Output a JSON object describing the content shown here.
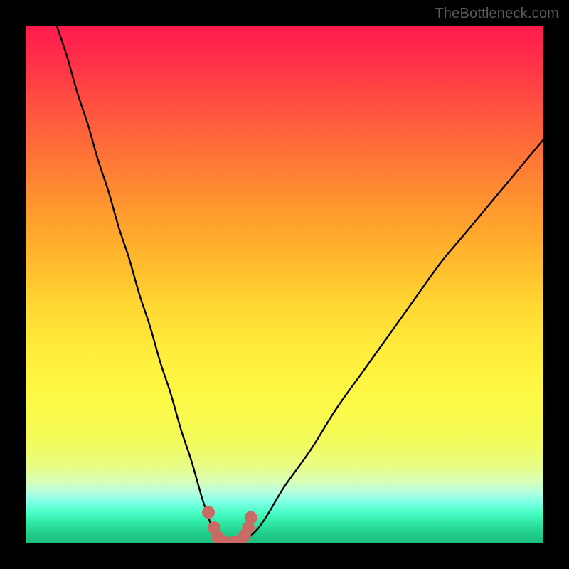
{
  "watermark": {
    "text": "TheBottleneck.com"
  },
  "colors": {
    "background": "#000000",
    "curve": "#000000",
    "marker": "#c96a64",
    "watermark": "#5a5a5a",
    "gradient_top": "#ff1a4d",
    "gradient_mid": "#ffe638",
    "gradient_bottom": "#1bbd7d"
  },
  "chart_data": {
    "type": "line",
    "title": "",
    "xlabel": "",
    "ylabel": "",
    "xlim": [
      0,
      100
    ],
    "ylim": [
      0,
      100
    ],
    "grid": false,
    "legend": false,
    "annotations": [],
    "series": [
      {
        "name": "bottleneck-curve",
        "x": [
          6,
          8,
          10,
          12,
          14,
          16,
          18,
          20,
          22,
          24,
          26,
          28,
          30,
          32,
          34,
          35,
          36,
          37,
          38,
          39,
          40,
          41,
          42,
          43,
          45,
          47,
          50,
          55,
          60,
          65,
          70,
          75,
          80,
          85,
          90,
          95,
          100
        ],
        "y": [
          100,
          94,
          87,
          81,
          74,
          68,
          61,
          55,
          48,
          42,
          35,
          29,
          22,
          16,
          9,
          6,
          3,
          1,
          0,
          0,
          0,
          0,
          0,
          1,
          3,
          6,
          11,
          18,
          26,
          33,
          40,
          47,
          54,
          60,
          66,
          72,
          78
        ]
      }
    ],
    "markers": {
      "name": "minimum-markers",
      "x": [
        35.3,
        36.4,
        37.0,
        38.2,
        40.0,
        41.3,
        42.3,
        43.0,
        43.5
      ],
      "y": [
        6.0,
        3.0,
        1.3,
        0.4,
        0.2,
        0.4,
        1.5,
        3.0,
        5.0
      ]
    }
  }
}
